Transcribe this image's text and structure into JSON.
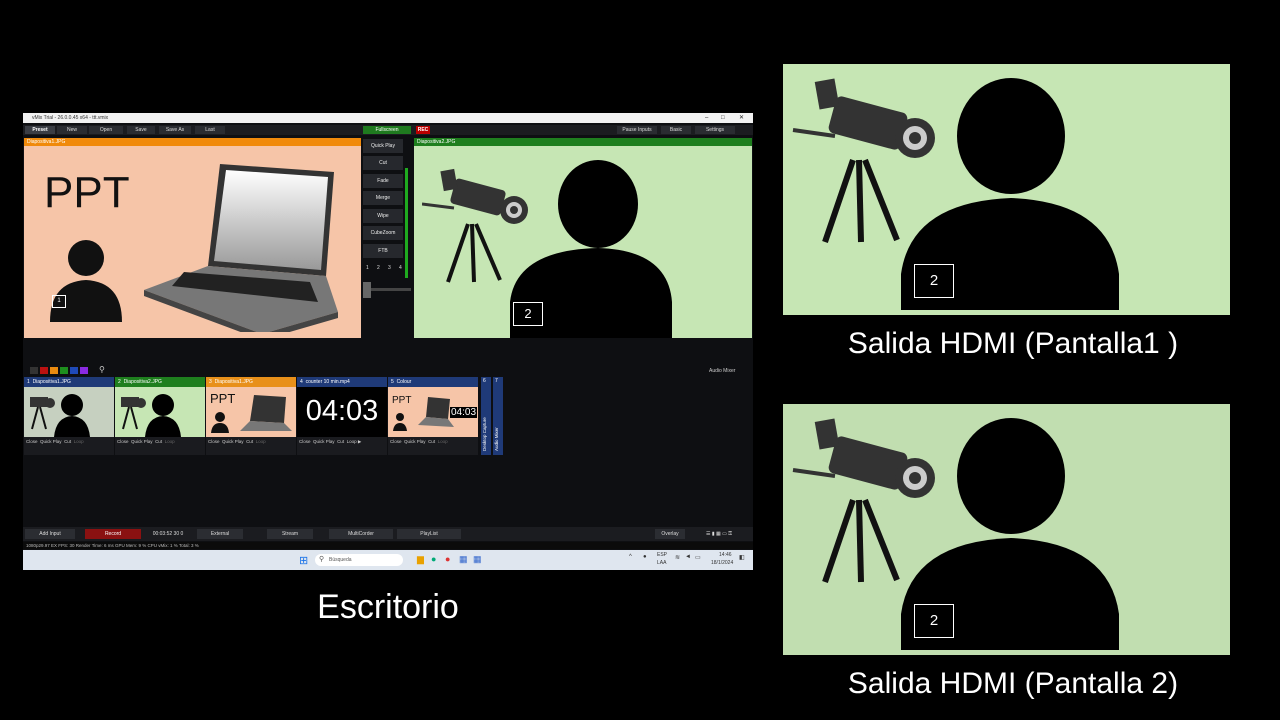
{
  "window": {
    "title": "vMix Trial - 26.0.0.45 x64 - ttt.vmix",
    "menu": [
      "Preset",
      "New",
      "Open",
      "Save",
      "Save As",
      "Last"
    ],
    "fullscreen_label": "Fullscreen",
    "rec_label": "REC",
    "right_menu": [
      "Pause Inputs",
      "Basic",
      "Settings"
    ]
  },
  "preview": {
    "header": "Diapositiva1.JPG",
    "ppt_text": "PPT",
    "badge": "1"
  },
  "output": {
    "header": "Diapositiva2.JPG",
    "badge": "2"
  },
  "transitions": {
    "buttons": [
      "Quick Play",
      "Cut",
      "Fade",
      "Merge",
      "Wipe",
      "CubeZoom",
      "FTB"
    ],
    "numbers": [
      "1",
      "2",
      "3",
      "4"
    ]
  },
  "audio_mixer_label": "Audio Mixer",
  "inputs": [
    {
      "num": "1",
      "name": "Diapositiva1.JPG",
      "color": "#1f3a78",
      "controls": [
        "Close",
        "Quick Play",
        "Cut",
        "Loop"
      ]
    },
    {
      "num": "2",
      "name": "Diapositiva2.JPG",
      "color": "#1e7f1e",
      "controls": [
        "Close",
        "Quick Play",
        "Cut",
        "Loop"
      ]
    },
    {
      "num": "3",
      "name": "Diapositiva1.JPG",
      "color": "#e8901a",
      "controls": [
        "Close",
        "Quick Play",
        "Cut",
        "Loop"
      ]
    },
    {
      "num": "4",
      "name": "counter 10 min.mp4",
      "color": "#1f3a78",
      "controls": [
        "Close",
        "Quick Play",
        "Cut",
        "Loop"
      ],
      "time": "04:03"
    },
    {
      "num": "5",
      "name": "Colour",
      "color": "#1f3a78",
      "controls": [
        "Close",
        "Quick Play",
        "Cut",
        "Loop"
      ],
      "time": "04:03"
    }
  ],
  "extra_tabs": [
    {
      "num": "6",
      "label": "Desktop Capture"
    },
    {
      "num": "7",
      "label": "Audio Mixer"
    }
  ],
  "input_numbers": [
    "1",
    "2",
    "3",
    "4"
  ],
  "audio_label": "Audio",
  "statusbar": {
    "add_input": "Add Input",
    "record": "Record",
    "timecode": "00:03:52 30 0",
    "external": "External",
    "stream": "Stream",
    "multicorder": "MultiCorder",
    "playlist": "PlayList",
    "overlay": "Overlay"
  },
  "perf": "1080p29.97   EX  FPS: 30  Render Time: 6 ms  GPU Mem: 9 %  CPU vMix: 1 %  Total: 3 %",
  "taskbar": {
    "search": "Búsqueda",
    "lang": "ESP",
    "lang2": "LAA",
    "time": "14:46",
    "date": "18/1/2024"
  },
  "captions": {
    "desktop": "Escritorio",
    "hdmi1": "Salida HDMI (Pantalla1 )",
    "hdmi2": "Salida HDMI (Pantalla 2)"
  },
  "hdmi_badge": "2",
  "colors": {
    "orange": "#f08a0b",
    "green": "#1e7f1e",
    "ppt_bg": "#f6c5a8",
    "slide2_bg": "#c6e6b4"
  }
}
